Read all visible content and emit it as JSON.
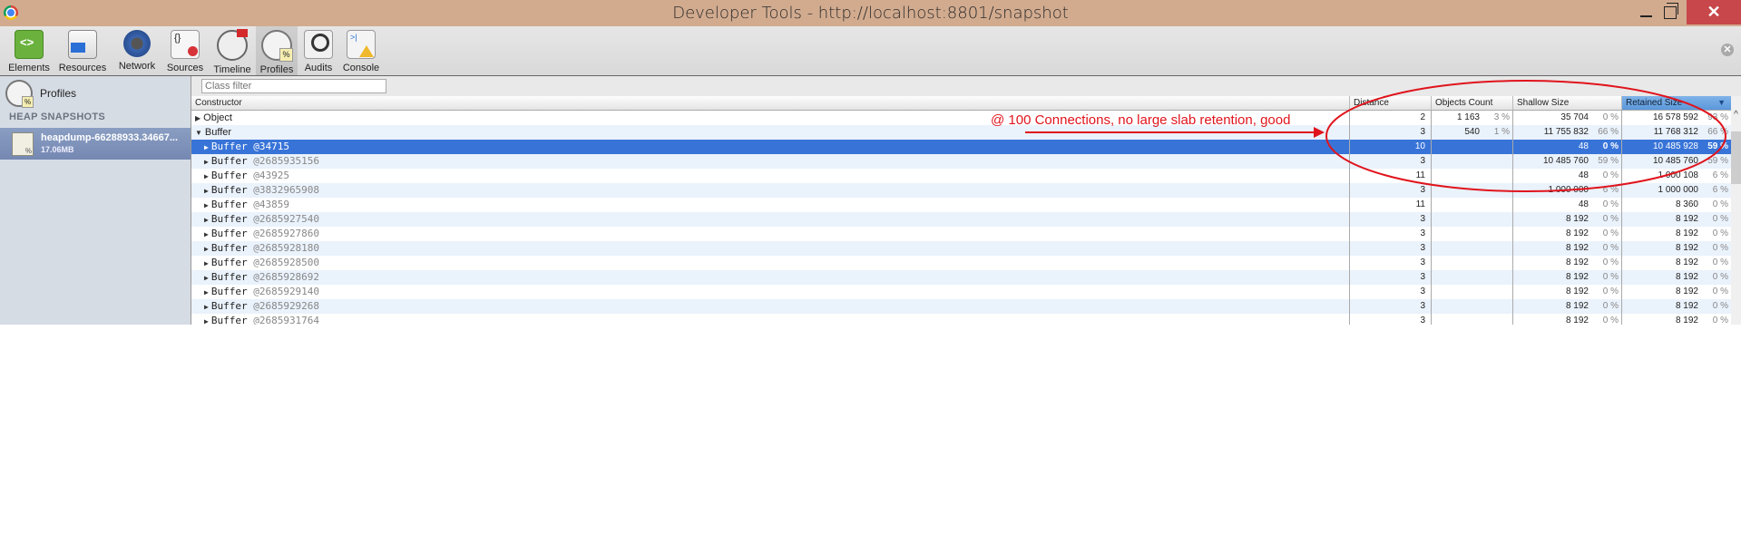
{
  "window": {
    "title": "Developer Tools - http://localhost:8801/snapshot",
    "minimize_icon": "minimize-icon",
    "maximize_icon": "restore-icon",
    "close_label": "✕"
  },
  "toolbar": {
    "tabs": [
      {
        "label": "Elements",
        "icon": "elements-icon"
      },
      {
        "label": "Resources",
        "icon": "resources-icon"
      },
      {
        "label": "Network",
        "icon": "network-icon"
      },
      {
        "label": "Sources",
        "icon": "sources-icon"
      },
      {
        "label": "Timeline",
        "icon": "timeline-icon"
      },
      {
        "label": "Profiles",
        "icon": "profiles-icon",
        "active": true
      },
      {
        "label": "Audits",
        "icon": "audits-icon"
      },
      {
        "label": "Console",
        "icon": "console-icon"
      }
    ],
    "close_glyph": "✕"
  },
  "sidebar": {
    "profiles_label": "Profiles",
    "heading": "HEAP SNAPSHOTS",
    "snapshot": {
      "name": "heapdump-66288933.34667...",
      "size": "17.06MB"
    }
  },
  "filter": {
    "placeholder": "Class filter",
    "value": ""
  },
  "table": {
    "columns": {
      "constructor": "Constructor",
      "distance": "Distance",
      "objects_count": "Objects Count",
      "shallow_size": "Shallow Size",
      "retained_size": "Retained Size",
      "sort_glyph": "▼"
    },
    "rows": [
      {
        "name": "Object",
        "addr": "",
        "expanded": false,
        "child": false,
        "distance": "2",
        "objects": "1 163",
        "objects_pct": "3 %",
        "shallow": "35 704",
        "shallow_pct": "0 %",
        "retained": "16 578 592",
        "retained_pct": "93 %"
      },
      {
        "name": "Buffer",
        "addr": "",
        "expanded": true,
        "child": false,
        "distance": "3",
        "objects": "540",
        "objects_pct": "1 %",
        "shallow": "11 755 832",
        "shallow_pct": "66 %",
        "retained": "11 768 312",
        "retained_pct": "66 %"
      },
      {
        "name": "Buffer",
        "addr": "@34715",
        "child": true,
        "selected": true,
        "distance": "10",
        "objects": "",
        "objects_pct": "",
        "shallow": "48",
        "shallow_pct": "0 %",
        "retained": "10 485 928",
        "retained_pct": "59 %"
      },
      {
        "name": "Buffer",
        "addr": "@2685935156",
        "child": true,
        "distance": "3",
        "objects": "",
        "objects_pct": "",
        "shallow": "10 485 760",
        "shallow_pct": "59 %",
        "retained": "10 485 760",
        "retained_pct": "59 %"
      },
      {
        "name": "Buffer",
        "addr": "@43925",
        "child": true,
        "distance": "11",
        "objects": "",
        "objects_pct": "",
        "shallow": "48",
        "shallow_pct": "0 %",
        "retained": "1 000 108",
        "retained_pct": "6 %"
      },
      {
        "name": "Buffer",
        "addr": "@3832965908",
        "child": true,
        "distance": "3",
        "objects": "",
        "objects_pct": "",
        "shallow": "1 000 000",
        "shallow_pct": "6 %",
        "retained": "1 000 000",
        "retained_pct": "6 %"
      },
      {
        "name": "Buffer",
        "addr": "@43859",
        "child": true,
        "distance": "11",
        "objects": "",
        "objects_pct": "",
        "shallow": "48",
        "shallow_pct": "0 %",
        "retained": "8 360",
        "retained_pct": "0 %"
      },
      {
        "name": "Buffer",
        "addr": "@2685927540",
        "child": true,
        "distance": "3",
        "objects": "",
        "objects_pct": "",
        "shallow": "8 192",
        "shallow_pct": "0 %",
        "retained": "8 192",
        "retained_pct": "0 %"
      },
      {
        "name": "Buffer",
        "addr": "@2685927860",
        "child": true,
        "distance": "3",
        "objects": "",
        "objects_pct": "",
        "shallow": "8 192",
        "shallow_pct": "0 %",
        "retained": "8 192",
        "retained_pct": "0 %"
      },
      {
        "name": "Buffer",
        "addr": "@2685928180",
        "child": true,
        "distance": "3",
        "objects": "",
        "objects_pct": "",
        "shallow": "8 192",
        "shallow_pct": "0 %",
        "retained": "8 192",
        "retained_pct": "0 %"
      },
      {
        "name": "Buffer",
        "addr": "@2685928500",
        "child": true,
        "distance": "3",
        "objects": "",
        "objects_pct": "",
        "shallow": "8 192",
        "shallow_pct": "0 %",
        "retained": "8 192",
        "retained_pct": "0 %"
      },
      {
        "name": "Buffer",
        "addr": "@2685928692",
        "child": true,
        "distance": "3",
        "objects": "",
        "objects_pct": "",
        "shallow": "8 192",
        "shallow_pct": "0 %",
        "retained": "8 192",
        "retained_pct": "0 %"
      },
      {
        "name": "Buffer",
        "addr": "@2685929140",
        "child": true,
        "distance": "3",
        "objects": "",
        "objects_pct": "",
        "shallow": "8 192",
        "shallow_pct": "0 %",
        "retained": "8 192",
        "retained_pct": "0 %"
      },
      {
        "name": "Buffer",
        "addr": "@2685929268",
        "child": true,
        "distance": "3",
        "objects": "",
        "objects_pct": "",
        "shallow": "8 192",
        "shallow_pct": "0 %",
        "retained": "8 192",
        "retained_pct": "0 %"
      },
      {
        "name": "Buffer",
        "addr": "@2685931764",
        "child": true,
        "distance": "3",
        "objects": "",
        "objects_pct": "",
        "shallow": "8 192",
        "shallow_pct": "0 %",
        "retained": "8 192",
        "retained_pct": "0 %"
      }
    ]
  },
  "annotation": {
    "text": "@ 100 Connections, no large slab retention, good",
    "color": "#e0141c"
  },
  "colors": {
    "titlebar": "#d2ab8f",
    "selection": "#3874d8",
    "sidebar_selected": "#7e92bb",
    "close_button": "#c7474a"
  }
}
